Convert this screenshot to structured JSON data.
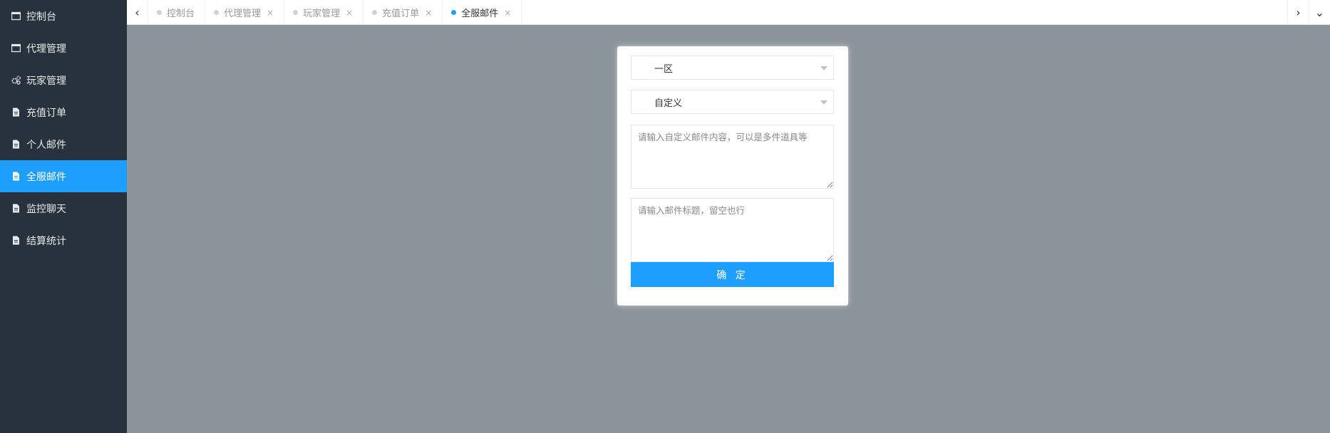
{
  "sidebar": {
    "items": [
      {
        "label": "控制台",
        "icon": "window-icon"
      },
      {
        "label": "代理管理",
        "icon": "window-icon"
      },
      {
        "label": "玩家管理",
        "icon": "gears-icon"
      },
      {
        "label": "充值订单",
        "icon": "file-icon"
      },
      {
        "label": "个人邮件",
        "icon": "file-icon"
      },
      {
        "label": "全服邮件",
        "icon": "file-icon",
        "active": true
      },
      {
        "label": "监控聊天",
        "icon": "file-icon"
      },
      {
        "label": "结算统计",
        "icon": "file-icon"
      }
    ]
  },
  "tabbar": {
    "prev_icon": "‹",
    "next_icon": "›",
    "menu_icon": "⌄",
    "tabs": [
      {
        "label": "控制台",
        "closable": false
      },
      {
        "label": "代理管理",
        "closable": true
      },
      {
        "label": "玩家管理",
        "closable": true
      },
      {
        "label": "充值订单",
        "closable": true
      },
      {
        "label": "全服邮件",
        "closable": true,
        "active": true
      }
    ],
    "close_glyph": "×"
  },
  "form": {
    "server_select": "一区",
    "type_select": "自定义",
    "content_placeholder": "请输入自定义邮件内容，可以是多件道具等",
    "title_placeholder": "请输入邮件标题，留空也行",
    "submit_label": "确 定"
  },
  "colors": {
    "accent": "#1e9fff",
    "sidebar_bg": "#28323c",
    "overlay_bg": "#8b939b"
  }
}
